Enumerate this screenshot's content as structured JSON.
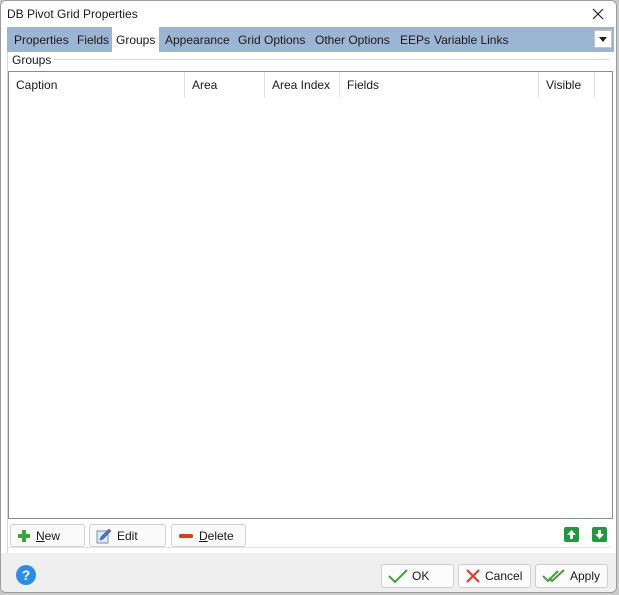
{
  "window": {
    "title": "DB Pivot Grid Properties",
    "close_icon": "close-icon"
  },
  "tabs": [
    {
      "label": "Properties",
      "active": false
    },
    {
      "label": "Fields",
      "active": false
    },
    {
      "label": "Groups",
      "active": true
    },
    {
      "label": "Appearance",
      "active": false
    },
    {
      "label": "Grid Options",
      "active": false
    },
    {
      "label": "Other Options",
      "active": false
    },
    {
      "label": "EEPs",
      "active": false
    },
    {
      "label": "Variable Links",
      "active": false
    }
  ],
  "groups_panel": {
    "label": "Groups",
    "columns": [
      "Caption",
      "Area",
      "Area Index",
      "Fields",
      "Visible"
    ],
    "rows": []
  },
  "actions": {
    "new": {
      "mnemonic": "N",
      "rest": "ew",
      "icon": "plus-icon"
    },
    "edit": {
      "label": "Edit",
      "icon": "edit-pencil-icon"
    },
    "delete": {
      "mnemonic": "D",
      "rest": "elete",
      "icon": "minus-icon"
    },
    "move_up_icon": "arrow-up-icon",
    "move_down_icon": "arrow-down-icon"
  },
  "footer": {
    "help": "?",
    "ok": "OK",
    "cancel": "Cancel",
    "apply": "Apply"
  },
  "colors": {
    "tab_strip": "#9bb5d3",
    "active_tab": "#ffffff",
    "plus_green": "#3aa63a",
    "delete_red": "#d9401f",
    "arrow_green": "#1f9a3a",
    "help_blue": "#2a8ee8"
  }
}
